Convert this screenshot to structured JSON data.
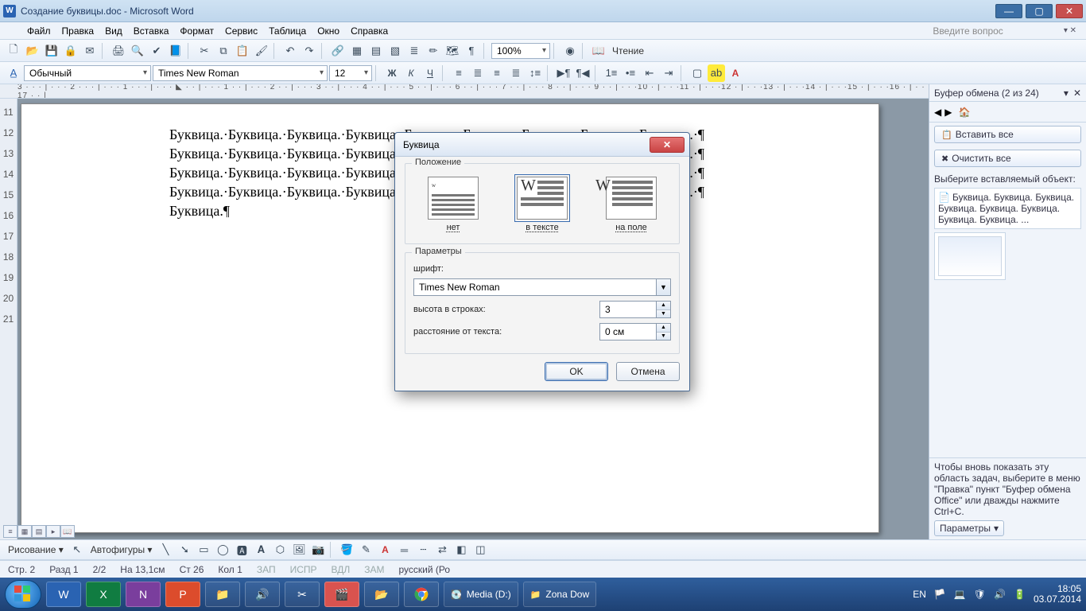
{
  "title": "Создание буквицы.doc - Microsoft Word",
  "menu": [
    "Файл",
    "Правка",
    "Вид",
    "Вставка",
    "Формат",
    "Сервис",
    "Таблица",
    "Окно",
    "Справка"
  ],
  "menu_search_placeholder": "Введите вопрос",
  "toolbar1": {
    "zoom": "100%",
    "reading": "Чтение"
  },
  "toolbar2": {
    "style": "Обычный",
    "font": "Times New Roman",
    "size": "12"
  },
  "ruler_text": "3 · · · | · · · 2 · · · | · · · 1 · · · | · · · ◣ · · | · · · 1 · · | · · · 2 · · | · · · 3 · · | · · · 4 · · | · · · 5 · · | · · · 6 · · | · · · 7 · · | · · · 8 · · | · · · 9 · · | · · ·10 · | · · ·11 · | · · ·12 · | · · ·13 · | · · ·14 · | · · ·15 · | · · ·16 · | · · 17 · · |",
  "vruler": [
    "11",
    "12",
    "13",
    "14",
    "15",
    "16",
    "17",
    "18",
    "19",
    "20",
    "21"
  ],
  "document": {
    "lines": [
      "Буквица.·Буквица.·Буквица.·Буквица.·Буквица.·Буквица.·Буквица.·Буквица.·Буквица.·¶",
      "Буквица.·Буквица.·Буквица.·Буквица.·Буквица.·Буквица.·Буквица.·Буквица.·Буквица.·¶",
      "Буквица.·Буквица.·Буквица.·Буквица.·Буквица.·Буквица.·Буквица.·Буквица.·Буквица.·¶",
      "Буквица.·Буквица.·Буквица.·Буквица.·Буквица.·Буквица.·Буквица.·Буквица.·Буквица.·¶",
      "Буквица.¶"
    ]
  },
  "taskpane": {
    "title": "Буфер обмена (2 из 24)",
    "paste_all": "Вставить все",
    "clear_all": "Очистить все",
    "label_choose": "Выберите вставляемый объект:",
    "clip_text": "Буквица. Буквица. Буквица. Буквица. Буквица. Буквица. Буквица. Буквица. ...",
    "tip": "Чтобы вновь показать эту область задач, выберите в меню \"Правка\" пункт \"Буфер обмена Office\" или дважды нажмите Ctrl+C.",
    "options": "Параметры"
  },
  "drawbar": {
    "drawing": "Рисование",
    "autoshapes": "Автофигуры"
  },
  "status": {
    "page": "Стр. 2",
    "section": "Разд 1",
    "pageof": "2/2",
    "at": "На 13,1см",
    "line": "Ст 26",
    "col": "Кол 1",
    "rec": "ЗАП",
    "trk": "ИСПР",
    "ext": "ВДЛ",
    "ovr": "ЗАМ",
    "lang": "русский (Ро"
  },
  "dialog": {
    "title": "Буквица",
    "group1": "Положение",
    "options": {
      "none": "нет",
      "dropped": "в тексте",
      "margin": "на поле"
    },
    "group2": "Параметры",
    "font_label": "шрифт:",
    "font_value": "Times New Roman",
    "lines_label": "высота в строках:",
    "lines_value": "3",
    "distance_label": "расстояние от текста:",
    "distance_value": "0 см",
    "ok": "OK",
    "cancel": "Отмена"
  },
  "taskbar": {
    "drive": "Media (D:)",
    "folder": "Zona Dow",
    "kb": "EN",
    "time": "18:05",
    "date": "03.07.2014"
  }
}
